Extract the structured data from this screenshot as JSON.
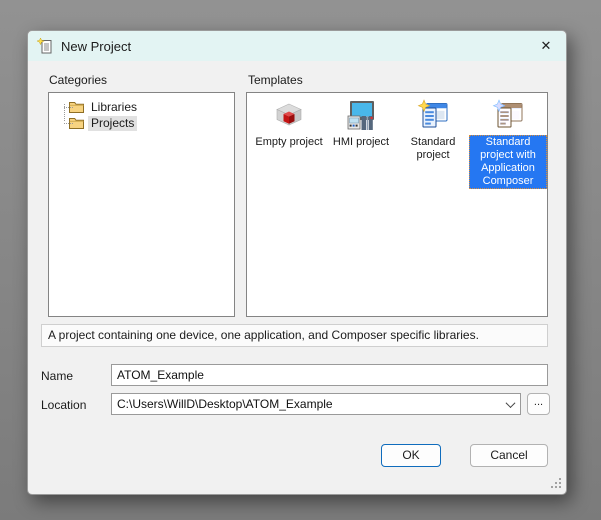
{
  "window": {
    "title": "New Project"
  },
  "icons": {
    "close": "✕"
  },
  "labels": {
    "categories": "Categories",
    "templates": "Templates"
  },
  "categories": {
    "items": [
      {
        "label": "Libraries",
        "selected": false
      },
      {
        "label": "Projects",
        "selected": true
      }
    ]
  },
  "templates": {
    "items": [
      {
        "label": "Empty project",
        "icon": "red-cube-box-icon",
        "selected": false
      },
      {
        "label": "HMI project",
        "icon": "hmi-panel-icon",
        "selected": false
      },
      {
        "label": "Standard project",
        "icon": "window-document-sparkle-icon",
        "selected": false
      },
      {
        "label": "Standard project with Application Composer",
        "icon": "window-document-sparkle-blue-icon",
        "selected": true
      }
    ]
  },
  "description": "A project containing one device, one application, and Composer specific libraries.",
  "form": {
    "name_label": "Name",
    "name_value": "ATOM_Example",
    "location_label": "Location",
    "location_value": "C:\\Users\\WillD\\Desktop\\ATOM_Example",
    "browse_label": "..."
  },
  "buttons": {
    "ok": "OK",
    "cancel": "Cancel"
  },
  "colors": {
    "selection_blue": "#2577f2",
    "titlebar_teal": "#e3f4f3",
    "focus_dots_orange": "#d98e3a",
    "ok_border_blue": "#0f6cbd"
  }
}
